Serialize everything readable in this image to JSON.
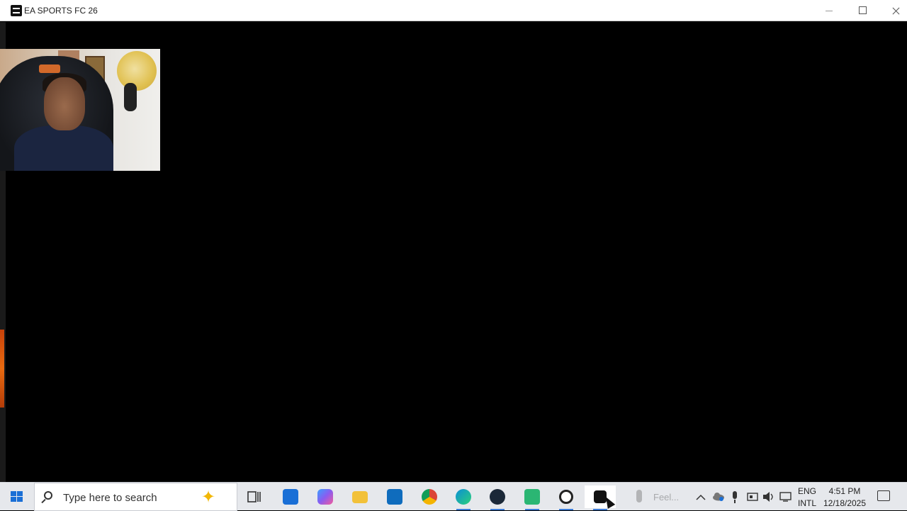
{
  "window": {
    "title": "EA SPORTS FC 26"
  },
  "taskbar": {
    "search": {
      "placeholder": "Type here to search"
    },
    "apps": [
      {
        "name": "Task View",
        "icon": "task-view-icon",
        "color": "#333333"
      },
      {
        "name": "Microsoft Store",
        "icon": "store-icon",
        "color": "#1a6fd6"
      },
      {
        "name": "Copilot",
        "icon": "copilot-icon",
        "color": "#8a5cf0"
      },
      {
        "name": "File Explorer",
        "icon": "folder-icon",
        "color": "#f2c13a"
      },
      {
        "name": "Outlook",
        "icon": "outlook-icon",
        "color": "#0f6cbd"
      },
      {
        "name": "Google Chrome",
        "icon": "chrome-icon",
        "color": "#db4437"
      },
      {
        "name": "Microsoft Edge",
        "icon": "edge-icon",
        "color": "#0b8fd6"
      },
      {
        "name": "Steam",
        "icon": "steam-icon",
        "color": "#1b2838"
      },
      {
        "name": "Game app",
        "icon": "game-icon",
        "color": "#2bb673"
      },
      {
        "name": "SteelSeries",
        "icon": "steelseries-icon",
        "color": "#222222"
      },
      {
        "name": "EA SPORTS FC 26",
        "icon": "ea-fc-icon",
        "color": "#111111",
        "active": true
      }
    ],
    "weather": {
      "text": "Feel..."
    },
    "language": {
      "line1": "ENG",
      "line2": "INTL"
    },
    "clock": {
      "time": "4:51 PM",
      "date": "12/18/2025"
    }
  }
}
